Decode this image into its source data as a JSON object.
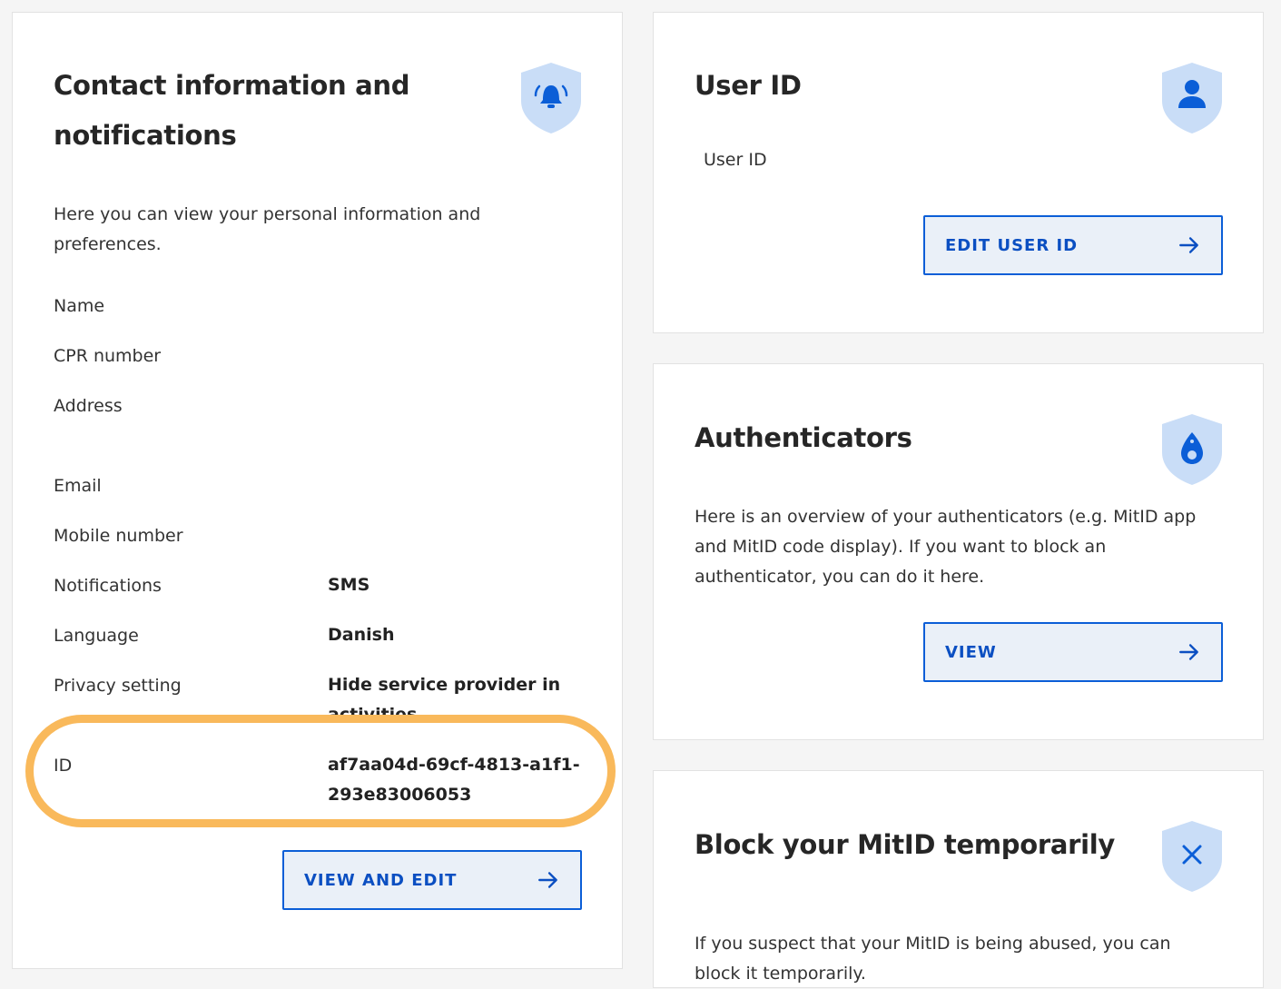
{
  "contact": {
    "title": "Contact information and notifications",
    "description": "Here you can view your personal information and preferences.",
    "rows": [
      {
        "label": "Name",
        "value": ""
      },
      {
        "label": "CPR number",
        "value": ""
      },
      {
        "label": "Address",
        "value": ""
      },
      {
        "label": "Email",
        "value": ""
      },
      {
        "label": "Mobile number",
        "value": ""
      },
      {
        "label": "Notifications",
        "value": "SMS"
      },
      {
        "label": "Language",
        "value": "Danish"
      },
      {
        "label": "Privacy setting",
        "value": "Hide service provider in activities"
      },
      {
        "label": "ID",
        "value": "af7aa04d-69cf-4813-a1f1-293e83006053"
      }
    ],
    "button_label": "VIEW AND EDIT",
    "icon": "bell-alarm-icon"
  },
  "userid": {
    "title": "User ID",
    "label": "User ID",
    "button_label": "EDIT USER ID",
    "icon": "user-icon"
  },
  "authenticators": {
    "title": "Authenticators",
    "description": "Here is an overview of your authenticators (e.g. MitID app and MitID code display). If you want to block an authenticator, you can do it here.",
    "button_label": "VIEW",
    "icon": "code-display-icon"
  },
  "block": {
    "title": "Block your MitID temporarily",
    "description": "If you suspect that your MitID is being abused, you can block it temporarily.",
    "icon": "close-icon"
  },
  "colors": {
    "accent": "#0b5ed7",
    "shield_fill": "#c9ddf7",
    "highlight": "#f9b95b"
  }
}
